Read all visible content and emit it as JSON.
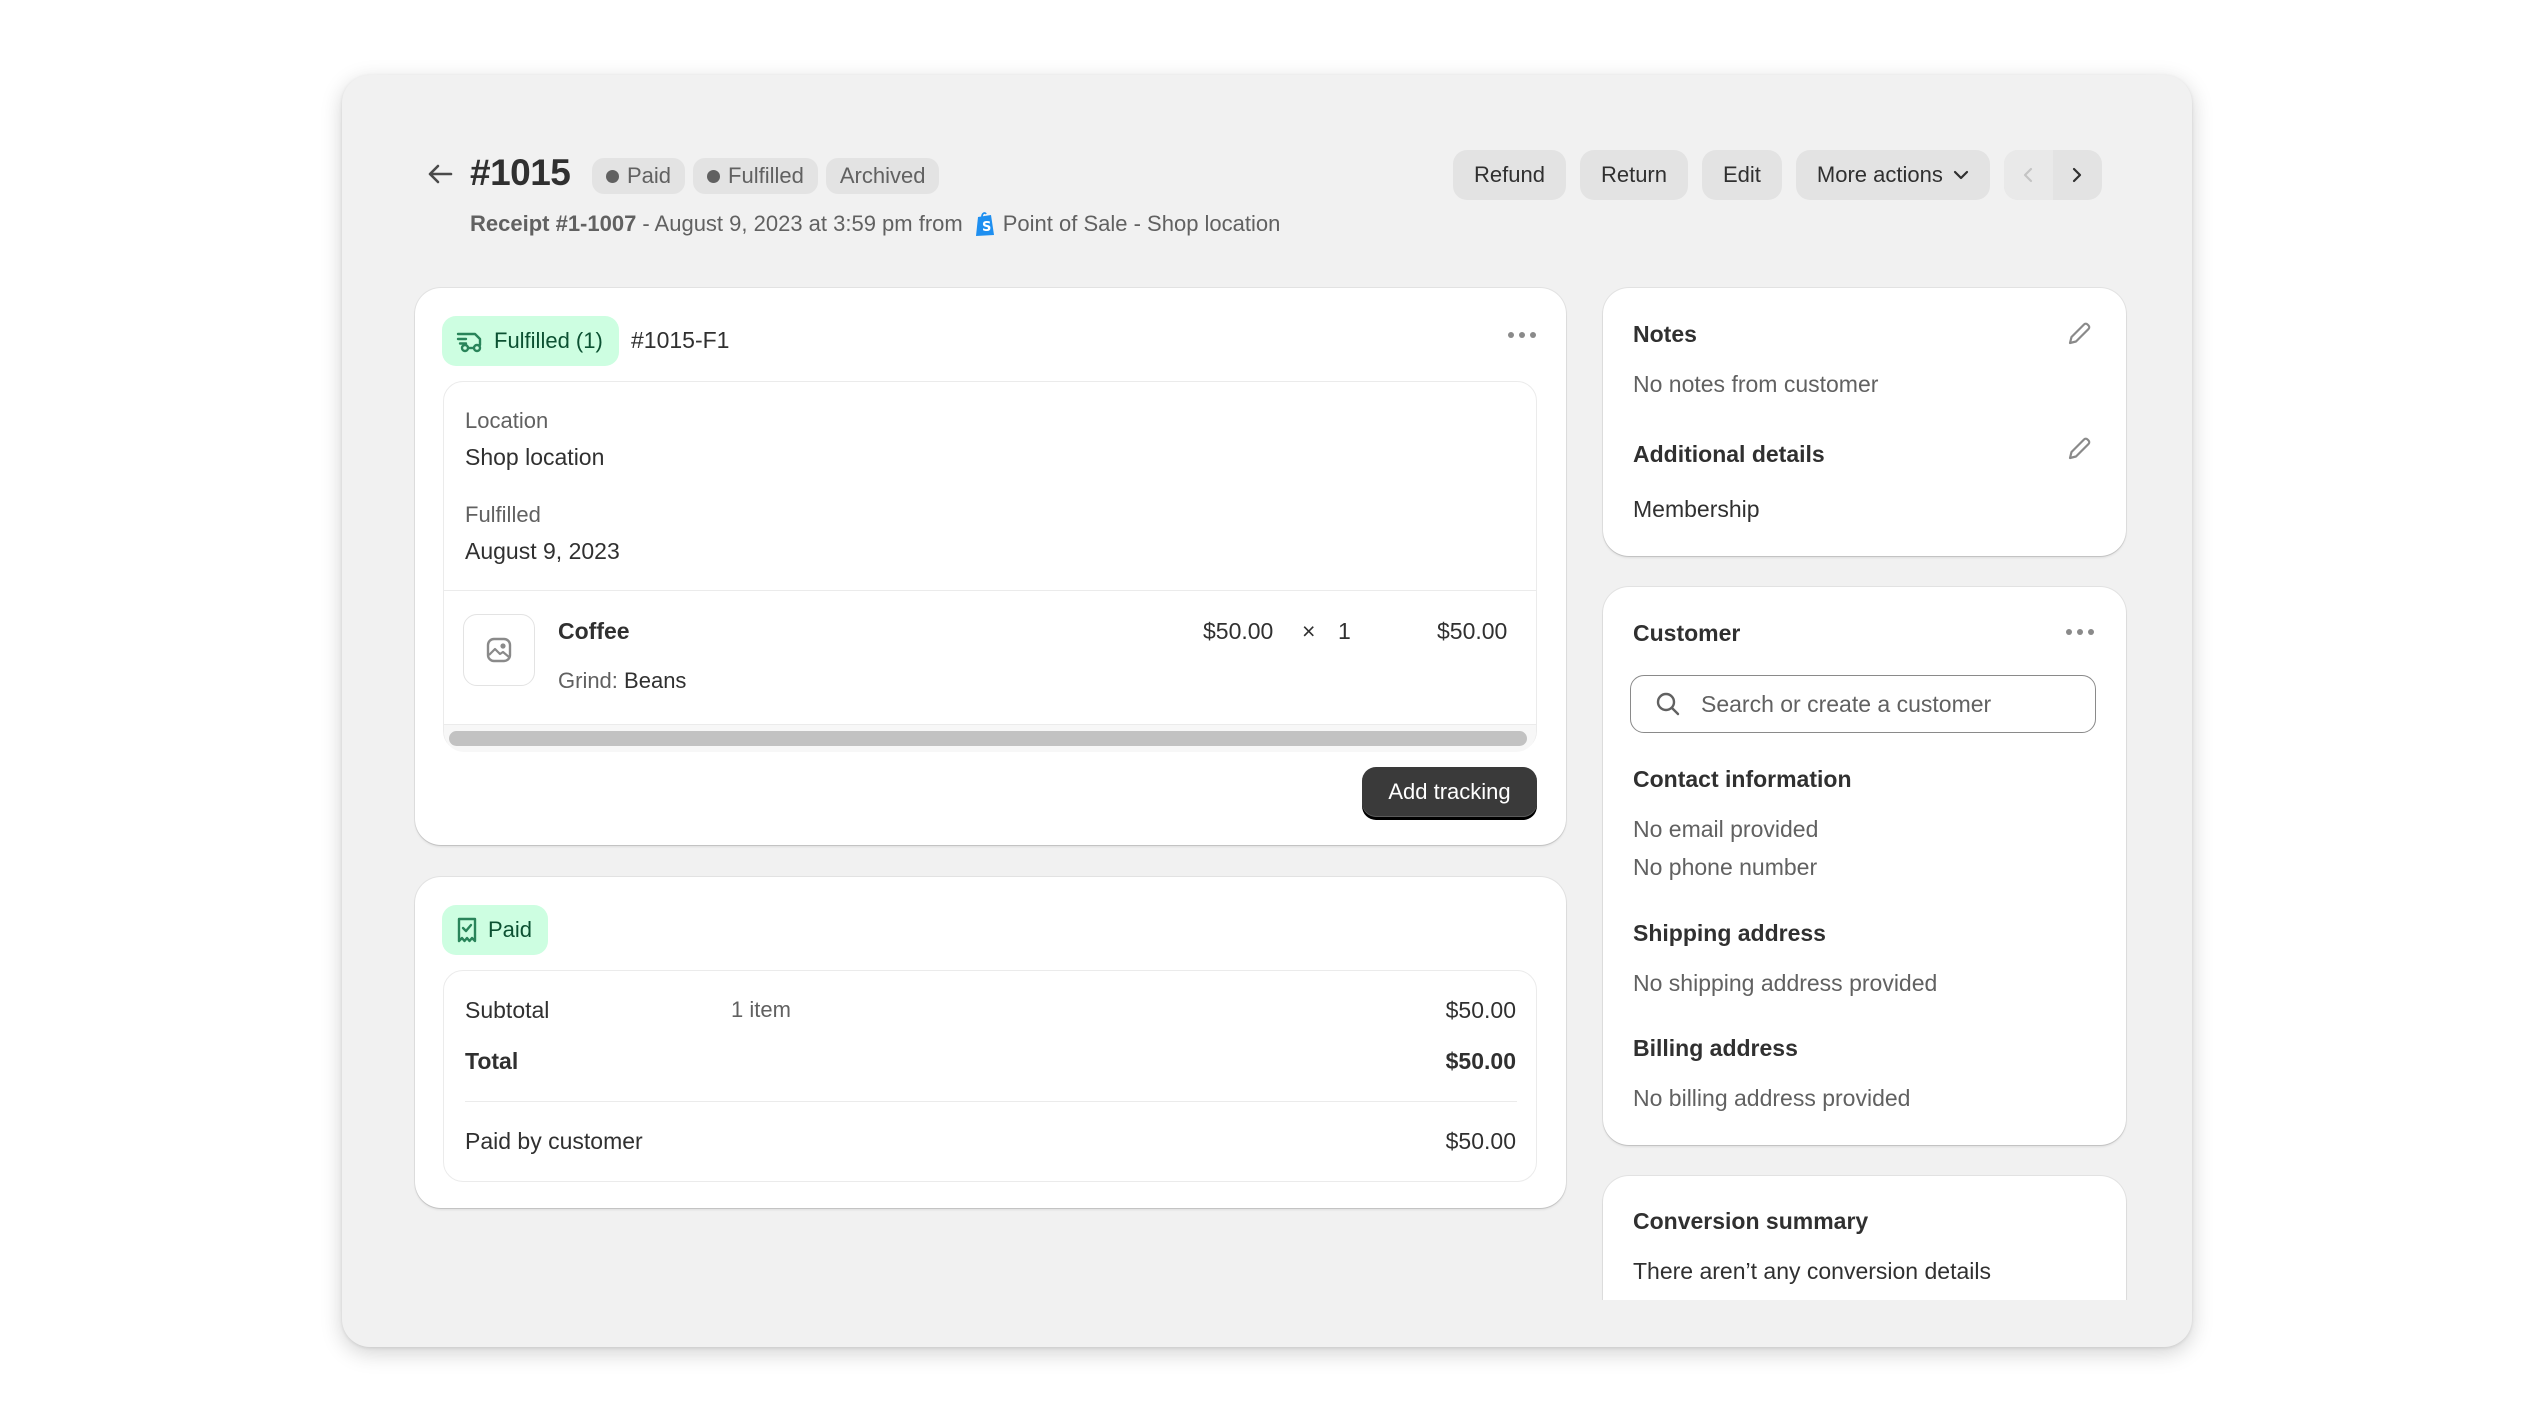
{
  "header": {
    "order_number": "#1015",
    "badges": [
      {
        "label": "Paid",
        "dot": true
      },
      {
        "label": "Fulfilled",
        "dot": true
      },
      {
        "label": "Archived",
        "dot": false
      }
    ],
    "receipt": "Receipt #1-1007",
    "date_text": "- August 9, 2023 at 3:59 pm from",
    "source": "Point of Sale - Shop location",
    "actions": {
      "refund": "Refund",
      "return": "Return",
      "edit": "Edit",
      "more_actions": "More actions"
    }
  },
  "fulfillment": {
    "status_label": "Fulfilled (1)",
    "fulfillment_id": "#1015-F1",
    "location_label": "Location",
    "location_value": "Shop location",
    "fulfilled_label": "Fulfilled",
    "fulfilled_date": "August 9, 2023",
    "line_item": {
      "name": "Coffee",
      "variant_label": "Grind:",
      "variant_value": "Beans",
      "unit_price": "$50.00",
      "times": "×",
      "quantity": "1",
      "total": "$50.00"
    },
    "add_tracking": "Add tracking"
  },
  "payment": {
    "status_label": "Paid",
    "subtotal_label": "Subtotal",
    "subtotal_items": "1 item",
    "subtotal_value": "$50.00",
    "total_label": "Total",
    "total_value": "$50.00",
    "paid_by_label": "Paid by customer",
    "paid_by_value": "$50.00"
  },
  "notes": {
    "title": "Notes",
    "text": "No notes from customer",
    "additional_title": "Additional details",
    "additional_text": "Membership"
  },
  "customer": {
    "title": "Customer",
    "search_placeholder": "Search or create a customer",
    "contact_title": "Contact information",
    "email_text": "No email provided",
    "phone_text": "No phone number",
    "shipping_title": "Shipping address",
    "shipping_text": "No shipping address provided",
    "billing_title": "Billing address",
    "billing_text": "No billing address provided"
  },
  "conversion": {
    "title": "Conversion summary",
    "text": "There aren’t any conversion details"
  },
  "colors": {
    "page_bg": "#f1f1f1",
    "success_bg": "#cdfee1",
    "success_fg": "#0c5132",
    "badge_bg": "#e3e3e3",
    "primary_btn": "#303030",
    "shopify_blue": "#1e8ff0"
  }
}
